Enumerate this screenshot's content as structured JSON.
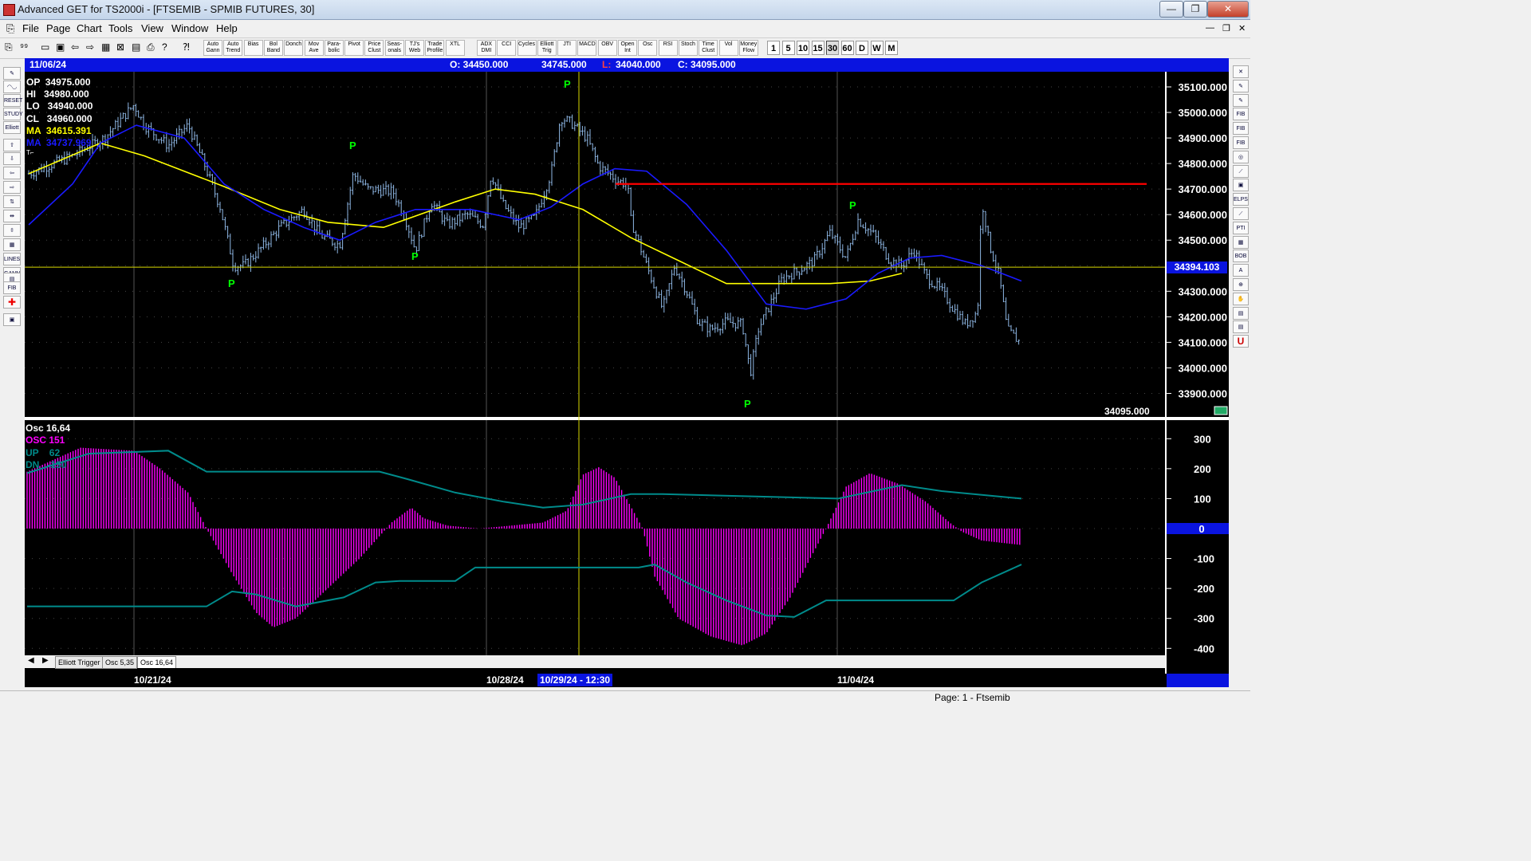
{
  "window": {
    "title": "Advanced GET for TS2000i - [FTSEMIB - SPMIB FUTURES, 30]",
    "controls": [
      "—",
      "❐",
      "✕"
    ]
  },
  "menu": [
    "File",
    "Page",
    "Chart",
    "Tools",
    "View",
    "Window",
    "Help"
  ],
  "toolbar": {
    "studies": [
      "Auto Gann",
      "Auto Trend",
      "Bias",
      "Bol Band",
      "Donch",
      "Mov Ave",
      "Para-bolic",
      "Pivot",
      "Price Clust",
      "Seas-onals",
      "TJ's Web",
      "Trade Profile",
      "XTL",
      "ADX DMI",
      "CCI",
      "Cycles",
      "Elliott Trig",
      "JTI",
      "MACD",
      "OBV",
      "Open Int",
      "Osc",
      "RSI",
      "Stoch",
      "Time Clust",
      "Vol",
      "Money Flow"
    ],
    "timeframes": [
      "1",
      "5",
      "10",
      "15",
      "30",
      "60",
      "D",
      "W",
      "M"
    ],
    "active_timeframe": "30"
  },
  "infobar": {
    "date": "11/06/24",
    "open": "O: 34450.000",
    "high": "34745.000",
    "low_prefix": "L:",
    "low": "34040.000",
    "close": "C: 34095.000"
  },
  "price_panel": {
    "op": "OP  34975.000",
    "hi": "HI   34980.000",
    "lo": "LO   34940.000",
    "cl": "CL   34960.000",
    "ma1": "MA  34615.391",
    "ma2": "MA  34737.969",
    "tl": "T⌐",
    "last_price": "34095.000",
    "crosshair_price": "34394.103",
    "resistance_level": 34720,
    "pivot_label": "P",
    "y_ticks": [
      "35100.000",
      "35000.000",
      "34900.000",
      "34800.000",
      "34700.000",
      "34600.000",
      "34500.000",
      "34400.000",
      "34300.000",
      "34200.000",
      "34100.000",
      "34000.000",
      "33900.000"
    ]
  },
  "osc_panel": {
    "title": "Osc 16,64",
    "osc": "OSC 151",
    "up": "UP    62",
    "dn": "DN   -130",
    "y_ticks": [
      "300",
      "200",
      "100",
      "0",
      "-100",
      "-200",
      "-300",
      "-400"
    ]
  },
  "tabs": [
    "Elliott Trigger",
    "Osc 5,35",
    "Osc 16,64"
  ],
  "active_tab": "Osc 16,64",
  "dates": {
    "d1": "10/21/24",
    "d2": "10/28/24",
    "cursor": "10/29/24 - 12:30",
    "d3": "11/04/24"
  },
  "status": "Page: 1 - Ftsemib",
  "colors": {
    "background": "#000000",
    "infobar": "#0a14e0",
    "ma_fast": "#ffff00",
    "ma_slow": "#1a1aff",
    "resistance": "#ff0000",
    "pivot": "#00ff00",
    "osc_bars": "#ff00ff",
    "osc_bands": "#008b8b"
  }
}
